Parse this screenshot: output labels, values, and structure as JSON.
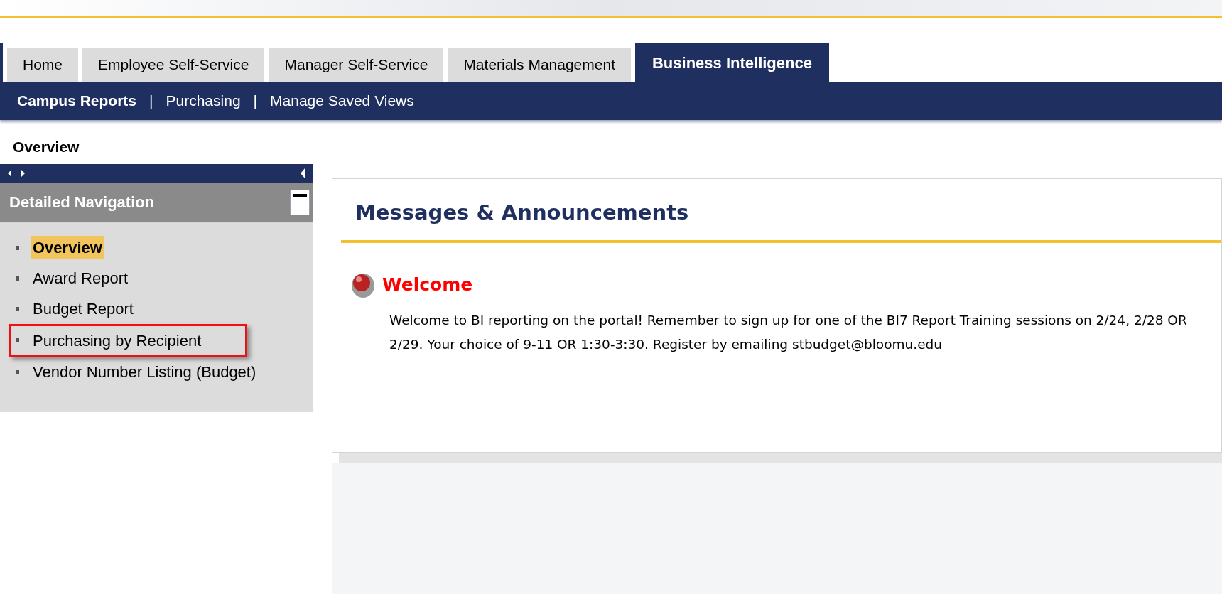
{
  "tabs": [
    {
      "label": "Home",
      "selected": false
    },
    {
      "label": "Employee Self-Service",
      "selected": false
    },
    {
      "label": "Manager Self-Service",
      "selected": false
    },
    {
      "label": "Materials Management",
      "selected": false
    },
    {
      "label": "Business Intelligence",
      "selected": true
    }
  ],
  "subnav": [
    {
      "label": "Campus Reports",
      "selected": true
    },
    {
      "label": "Purchasing",
      "selected": false
    },
    {
      "label": "Manage Saved Views",
      "selected": false
    }
  ],
  "subnav_separator": "|",
  "page_title": "Overview",
  "sidebar": {
    "title": "Detailed Navigation",
    "items": [
      {
        "label": "Overview",
        "selected": true,
        "highlighted": false
      },
      {
        "label": "Award Report",
        "selected": false,
        "highlighted": false
      },
      {
        "label": "Budget Report",
        "selected": false,
        "highlighted": false
      },
      {
        "label": "Purchasing by Recipient",
        "selected": false,
        "highlighted": true
      },
      {
        "label": "Vendor Number Listing (Budget)",
        "selected": false,
        "highlighted": false
      }
    ]
  },
  "messages": {
    "title": "Messages & Announcements",
    "heading": "Welcome",
    "text": "Welcome to BI reporting on the portal! Remember to sign up for one of the BI7 Report Training sessions on 2/24, 2/28 OR 2/29. Your choice of 9-11 OR 1:30-3:30. Register by emailing stbudget@bloomu.edu"
  }
}
